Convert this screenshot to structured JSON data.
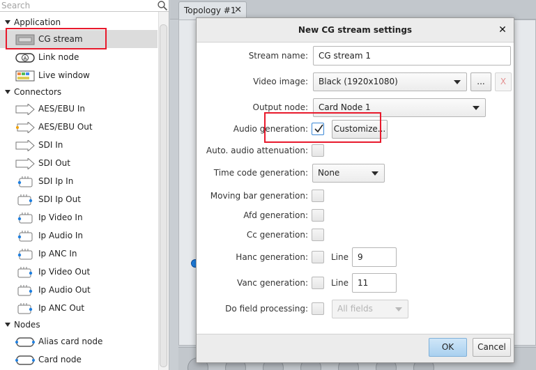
{
  "search": {
    "placeholder": "Search",
    "icon": "magnifier-icon"
  },
  "tree": {
    "groups": [
      {
        "label": "Application",
        "items": [
          {
            "label": "CG stream",
            "icon": "cg-stream-icon",
            "selected": true
          },
          {
            "label": "Link node",
            "icon": "link-node-icon"
          },
          {
            "label": "Live window",
            "icon": "live-window-icon"
          }
        ]
      },
      {
        "label": "Connectors",
        "items": [
          {
            "label": "AES/EBU In",
            "icon": "arrow-in-icon"
          },
          {
            "label": "AES/EBU Out",
            "icon": "arrow-out-icon"
          },
          {
            "label": "SDI In",
            "icon": "arrow-in-icon"
          },
          {
            "label": "SDI Out",
            "icon": "arrow-out-icon"
          },
          {
            "label": "SDI Ip In",
            "icon": "network-in-icon"
          },
          {
            "label": "SDI Ip Out",
            "icon": "network-out-icon"
          },
          {
            "label": "Ip Video In",
            "icon": "network-in-icon"
          },
          {
            "label": "Ip Audio In",
            "icon": "network-in-icon"
          },
          {
            "label": "Ip ANC In",
            "icon": "network-in-icon"
          },
          {
            "label": "Ip Video Out",
            "icon": "network-out-icon"
          },
          {
            "label": "Ip Audio Out",
            "icon": "network-out-icon"
          },
          {
            "label": "Ip ANC Out",
            "icon": "network-out-icon"
          }
        ]
      },
      {
        "label": "Nodes",
        "items": [
          {
            "label": "Alias card node",
            "icon": "card-node-icon"
          },
          {
            "label": "Card node",
            "icon": "card-node-icon"
          }
        ]
      }
    ]
  },
  "tab": {
    "label": "Topology #1",
    "close": "✕"
  },
  "dialog": {
    "title": "New CG stream settings",
    "close": "✕",
    "stream_name": {
      "label": "Stream name:",
      "value": "CG stream 1"
    },
    "video_image": {
      "label": "Video image:",
      "value": "Black (1920x1080)",
      "browse": "...",
      "clear": "X"
    },
    "output_node": {
      "label": "Output node:",
      "value": "Card Node 1"
    },
    "audio_generation": {
      "label": "Audio generation:",
      "checked": true,
      "customize": "Customize..."
    },
    "auto_audio_attenuation": {
      "label": "Auto. audio attenuation:",
      "checked": false
    },
    "time_code_generation": {
      "label": "Time code generation:",
      "value": "None"
    },
    "moving_bar_generation": {
      "label": "Moving bar generation:",
      "checked": false
    },
    "afd_generation": {
      "label": "Afd generation:",
      "checked": false
    },
    "cc_generation": {
      "label": "Cc generation:",
      "checked": false
    },
    "hanc_generation": {
      "label": "Hanc generation:",
      "checked": false,
      "line_label": "Line",
      "line_value": "9"
    },
    "vanc_generation": {
      "label": "Vanc generation:",
      "checked": false,
      "line_label": "Line",
      "line_value": "11"
    },
    "do_field_processing": {
      "label": "Do field processing:",
      "checked": false,
      "value": "All fields"
    },
    "ok": "OK",
    "cancel": "Cancel"
  },
  "colors": {
    "highlight": "#e8192c",
    "accent": "#1e7fe0",
    "ok_button": "#b9d9f3"
  }
}
